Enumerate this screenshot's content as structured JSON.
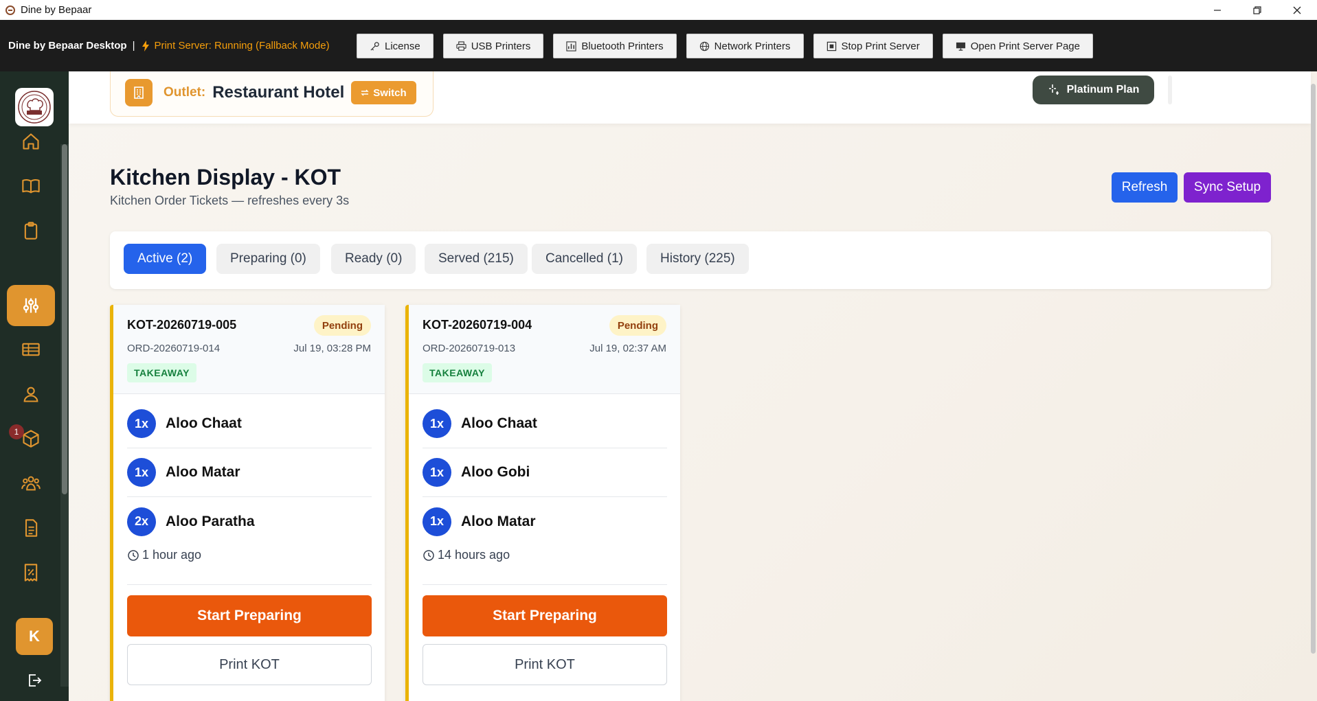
{
  "window": {
    "title": "Dine by Bepaar",
    "controls": [
      "minimize",
      "restore",
      "close"
    ]
  },
  "print_server_bar": {
    "brand": "Dine by Bepaar Desktop",
    "separator": "|",
    "status": "Print Server: Running (Fallback Mode)",
    "buttons": [
      {
        "label": "License",
        "icon": "key-icon"
      },
      {
        "label": "USB Printers",
        "icon": "printer-icon"
      },
      {
        "label": "Bluetooth Printers",
        "icon": "bar-chart-icon"
      },
      {
        "label": "Network Printers",
        "icon": "globe-icon"
      },
      {
        "label": "Stop Print Server",
        "icon": "stop-icon"
      },
      {
        "label": "Open Print Server Page",
        "icon": "monitor-icon"
      }
    ]
  },
  "sidebar": {
    "items": [
      {
        "name": "home",
        "icon": "home-icon"
      },
      {
        "name": "menu",
        "icon": "book-icon"
      },
      {
        "name": "orders",
        "icon": "clipboard-icon"
      },
      {
        "name": "kitchen",
        "icon": "sliders-icon",
        "active": true
      },
      {
        "name": "tables",
        "icon": "table-icon"
      },
      {
        "name": "customers",
        "icon": "users-icon"
      },
      {
        "name": "inventory",
        "icon": "box-icon",
        "badge": "1"
      },
      {
        "name": "staff",
        "icon": "team-icon"
      },
      {
        "name": "reports",
        "icon": "document-icon"
      },
      {
        "name": "discounts",
        "icon": "receipt-percent-icon"
      }
    ],
    "user_initial": "K",
    "logout_icon": "logout-icon"
  },
  "topbar": {
    "outlet_label": "Outlet:",
    "outlet_name": "Restaurant Hotel",
    "switch_label": "Switch",
    "plan_label": "Platinum Plan"
  },
  "page": {
    "title": "Kitchen Display - KOT",
    "subtitle": "Kitchen Order Tickets — refreshes every 3s",
    "refresh_label": "Refresh",
    "sync_label": "Sync Setup"
  },
  "tabs": [
    {
      "label": "Active (2)",
      "active": true
    },
    {
      "label": "Preparing (0)"
    },
    {
      "label": "Ready (0)"
    },
    {
      "label": "Served (215)"
    },
    {
      "label": "Cancelled (1)"
    },
    {
      "label": "History (225)"
    }
  ],
  "kots": [
    {
      "id": "KOT-20260719-005",
      "status": "Pending",
      "order": "ORD-20260719-014",
      "time": "Jul 19, 03:28 PM",
      "type": "TAKEAWAY",
      "items": [
        {
          "qty": "1x",
          "name": "Aloo Chaat"
        },
        {
          "qty": "1x",
          "name": "Aloo Matar"
        },
        {
          "qty": "2x",
          "name": "Aloo Paratha"
        }
      ],
      "ago": "1 hour ago",
      "start_label": "Start Preparing",
      "print_label": "Print KOT"
    },
    {
      "id": "KOT-20260719-004",
      "status": "Pending",
      "order": "ORD-20260719-013",
      "time": "Jul 19, 02:37 AM",
      "type": "TAKEAWAY",
      "items": [
        {
          "qty": "1x",
          "name": "Aloo Chaat"
        },
        {
          "qty": "1x",
          "name": "Aloo Gobi"
        },
        {
          "qty": "1x",
          "name": "Aloo Matar"
        }
      ],
      "ago": "14 hours ago",
      "start_label": "Start Preparing",
      "print_label": "Print KOT"
    }
  ],
  "colors": {
    "sidebar_bg": "#1f2d26",
    "accent_orange": "#e0952f",
    "primary_blue": "#2563eb",
    "purple": "#7e22ce",
    "start_button": "#ea580c",
    "pending_bg": "#fef3c7",
    "takeaway_bg": "#dcfce7",
    "kot_border": "#eab308"
  }
}
